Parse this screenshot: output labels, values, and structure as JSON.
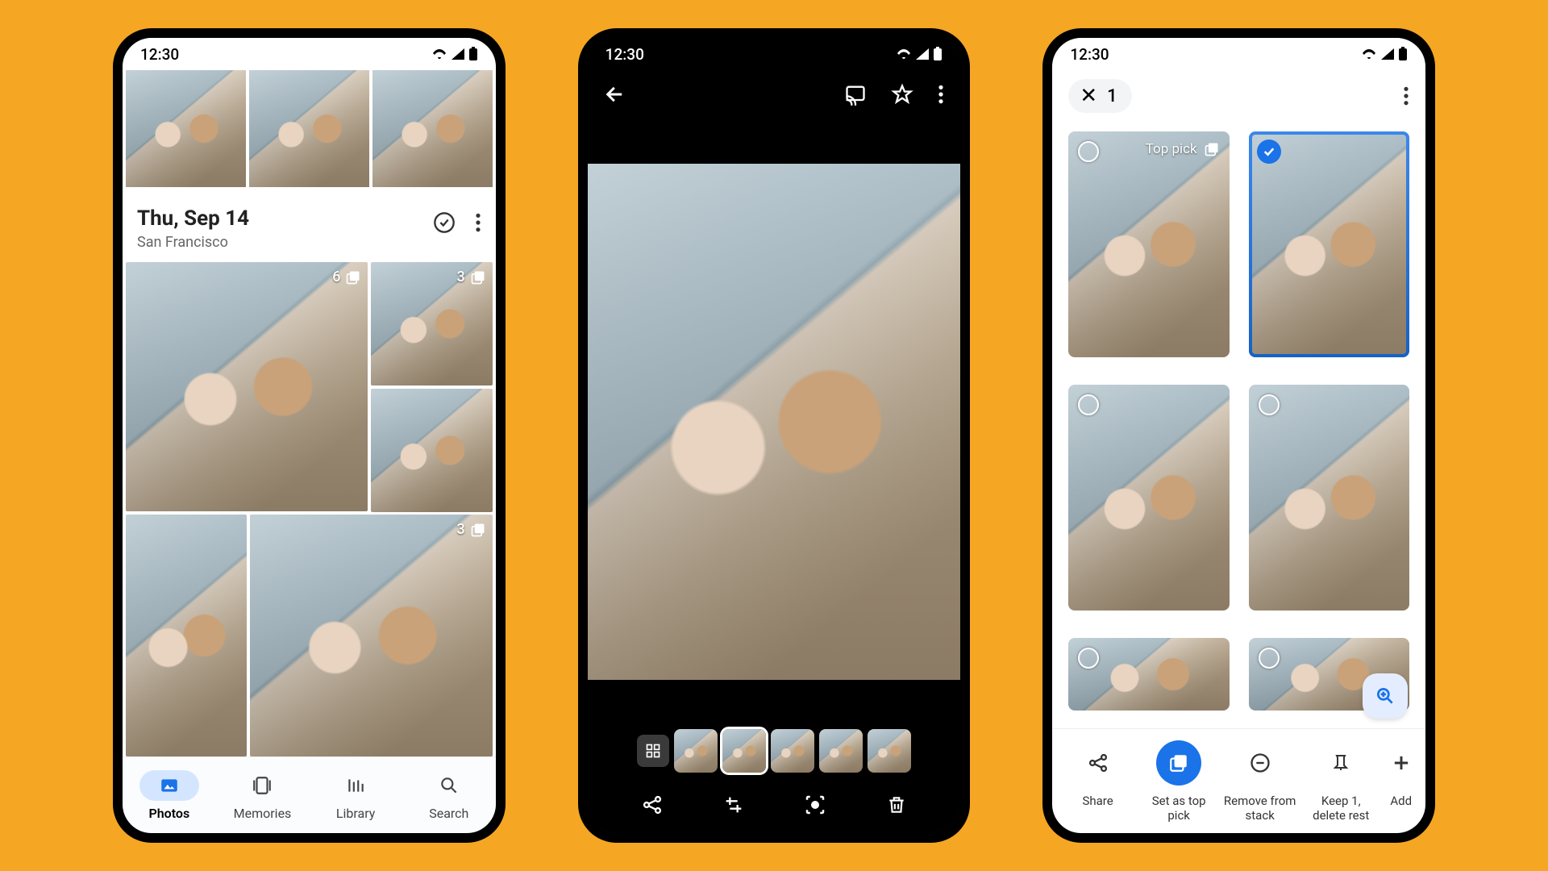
{
  "status_time": "12:30",
  "phone1": {
    "date": "Thu, Sep 14",
    "location": "San Francisco",
    "badges": {
      "big": "6",
      "sm1": "3",
      "sm3": "3"
    },
    "nav": [
      {
        "id": "photos",
        "label": "Photos",
        "active": true
      },
      {
        "id": "memories",
        "label": "Memories",
        "active": false
      },
      {
        "id": "library",
        "label": "Library",
        "active": false
      },
      {
        "id": "search",
        "label": "Search",
        "active": false
      }
    ]
  },
  "phone2": {
    "strip_count": 5,
    "active_index": 1
  },
  "phone3": {
    "selected_count": "1",
    "top_pick_label": "Top pick",
    "actions": [
      {
        "id": "share",
        "label": "Share"
      },
      {
        "id": "setpick",
        "label": "Set as top pick",
        "highlight": true
      },
      {
        "id": "remove",
        "label": "Remove from stack"
      },
      {
        "id": "keep",
        "label": "Keep 1, delete rest"
      },
      {
        "id": "add",
        "label": "Add"
      }
    ]
  }
}
